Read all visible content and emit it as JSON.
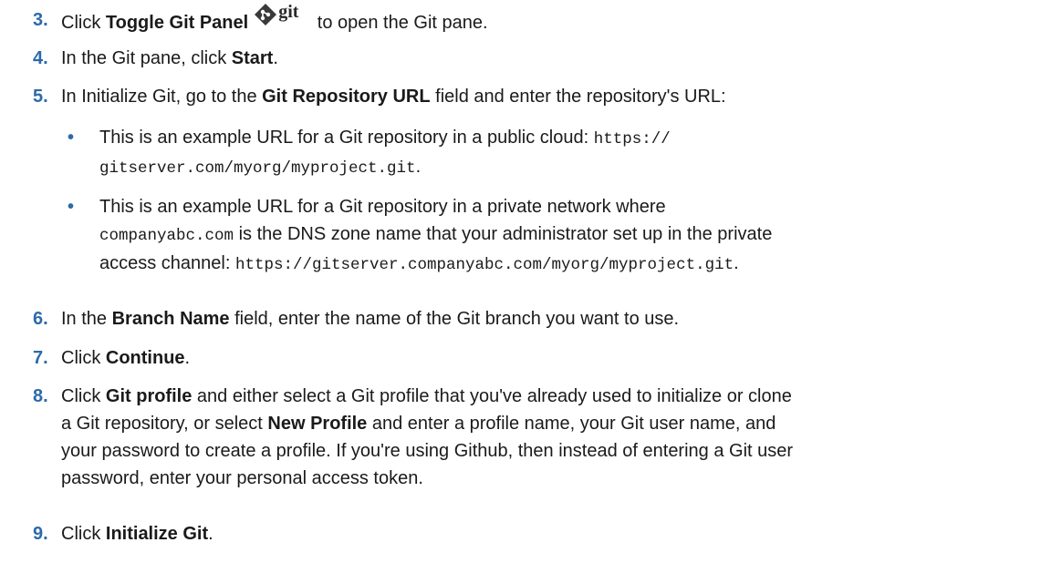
{
  "steps": [
    {
      "num": "3.",
      "pre": "Click ",
      "b1": "Toggle Git Panel",
      "post": " to open the Git pane.",
      "icon_label": "git"
    },
    {
      "num": "4.",
      "pre": "In the Git pane, click ",
      "b1": "Start",
      "post": "."
    },
    {
      "num": "5.",
      "pre": "In Initialize Git, go to the ",
      "b1": "Git Repository URL",
      "post": " field and enter the repository's URL:"
    },
    {
      "num": "6.",
      "pre": "In the ",
      "b1": "Branch Name",
      "post": " field, enter the name of the Git branch you want to use."
    },
    {
      "num": "7.",
      "pre": "Click ",
      "b1": "Continue",
      "post": "."
    },
    {
      "num": "8.",
      "line1_pre": "Click ",
      "line1_b": "Git profile",
      "line1_post": " and either select a Git profile that you've already used to initialize or clone",
      "line2_pre": "a Git repository, or select ",
      "line2_b": "New Profile",
      "line2_post": " and enter a profile name, your Git user name, and",
      "line3": "your password to create a profile. If you're using Github, then instead of entering a Git user",
      "line4": "password, enter your personal access token."
    },
    {
      "num": "9.",
      "pre": "Click ",
      "b1": "Initialize Git",
      "post": "."
    }
  ],
  "bullets": [
    {
      "dot": "•",
      "line1_text": "This is an example URL for a Git repository in a public cloud: ",
      "line1_code": "https://",
      "line2_code": "gitserver.com/myorg/myproject.git",
      "line2_post": "."
    },
    {
      "dot": "•",
      "line1": "This is an example URL for a Git repository in a private network where",
      "line2_code": "companyabc.com",
      "line2_post": " is the DNS zone name that your administrator set up in the private",
      "line3_pre": "access channel: ",
      "line3_code": "https://gitserver.companyabc.com/myorg/myproject.git",
      "line3_post": "."
    }
  ],
  "colors": {
    "number": "#2c6aa8",
    "text": "#1a1a1a"
  },
  "icons": {
    "toggle_git": "git-diamond-icon"
  }
}
